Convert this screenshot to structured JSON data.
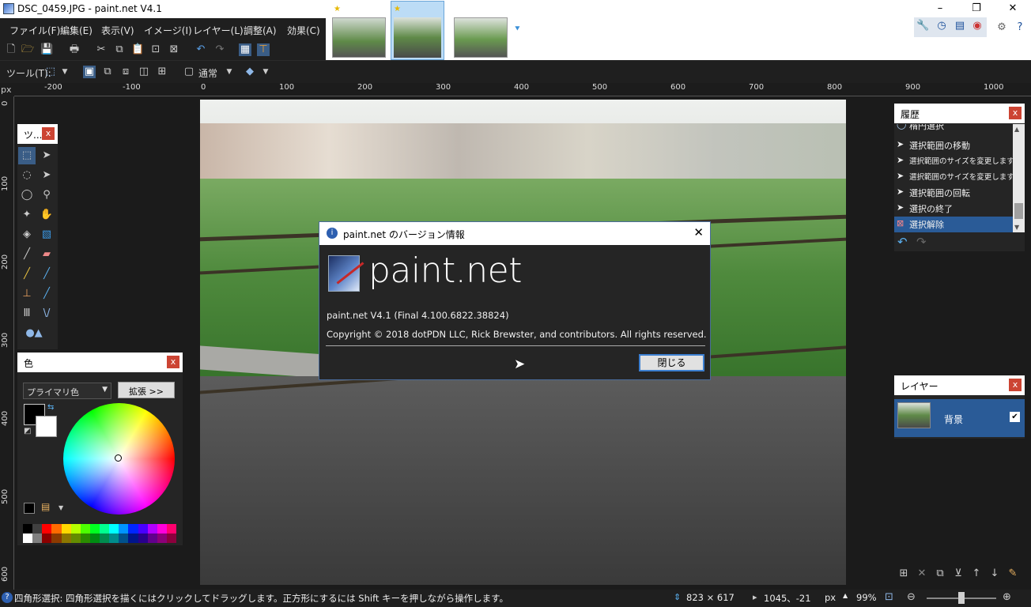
{
  "window": {
    "title": "DSC_0459.JPG - paint.net V4.1",
    "minimize": "–",
    "maximize": "❐",
    "close": "✕"
  },
  "menu": [
    "ファイル(F)",
    "編集(E)",
    "表示(V)",
    "イメージ(I)",
    "レイヤー(L)",
    "調整(A)",
    "効果(C)"
  ],
  "toolbar2": {
    "tool_label": "ツール(T):",
    "blend_mode": "通常"
  },
  "ruler": {
    "unit": "px",
    "top_ticks": [
      "-200",
      "-100",
      "0",
      "100",
      "200",
      "300",
      "400",
      "500",
      "600",
      "700",
      "800",
      "900",
      "1000"
    ],
    "left_ticks": [
      "0",
      "100",
      "200",
      "300",
      "400",
      "500",
      "600"
    ]
  },
  "tools_panel": {
    "title": "ツ...",
    "close": "x"
  },
  "colors_panel": {
    "title": "色",
    "close": "x",
    "primary_select": "プライマリ色",
    "expand_button": "拡張 >>"
  },
  "palette": [
    "#000000",
    "#404040",
    "#ff0000",
    "#ff6a00",
    "#ffd800",
    "#b6ff00",
    "#4cff00",
    "#00ff21",
    "#00ff90",
    "#00ffff",
    "#0094ff",
    "#0026ff",
    "#4800ff",
    "#b200ff",
    "#ff00dc",
    "#ff006e"
  ],
  "history_panel": {
    "title": "履歴",
    "close": "x",
    "items": [
      "楕円選択",
      "選択範囲の移動",
      "選択範囲のサイズを変更します。",
      "選択範囲のサイズを変更します。",
      "選択範囲の回転",
      "選択の終了",
      "選択解除"
    ]
  },
  "layers_panel": {
    "title": "レイヤー",
    "close": "x",
    "layer_name": "背景"
  },
  "dialog": {
    "title": "paint.net のバージョン情報",
    "logo_text": "paint.net",
    "version": "paint.net V4.1 (Final 4.100.6822.38824)",
    "copyright": "Copyright © 2018 dotPDN LLC, Rick Brewster, and contributors. All rights reserved.",
    "close_button": "閉じる"
  },
  "statusbar": {
    "hint": "四角形選択: 四角形選択を描くにはクリックしてドラッグします。正方形にするには Shift キーを押しながら操作します。",
    "size": "823 × 617",
    "position": "1045、-21",
    "unit": "px",
    "zoom": "99%"
  }
}
